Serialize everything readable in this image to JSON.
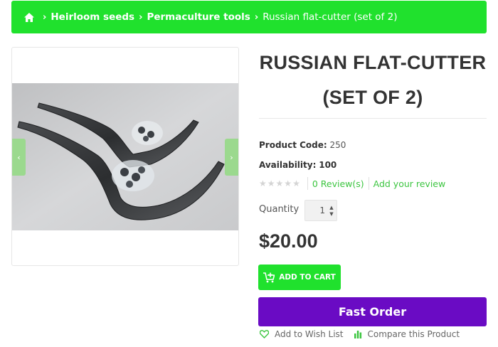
{
  "breadcrumb": {
    "items": [
      "Heirloom seeds",
      "Permaculture tools"
    ],
    "current": "Russian flat-cutter (set of 2)"
  },
  "product": {
    "title_line1": "RUSSIAN FLAT-CUTTER",
    "title_line2": "(SET OF 2)",
    "code_label": "Product Code:",
    "code_value": "250",
    "availability_label": "Availability:",
    "availability_value": "100",
    "rating_stars": 0,
    "reviews_link": "0 Review(s)",
    "add_review_link": "Add your review",
    "quantity_label": "Quantity",
    "quantity_value": "1",
    "price": "$20.00"
  },
  "actions": {
    "add_to_cart": "ADD TO CART",
    "fast_order": "Fast Order",
    "wishlist": "Add to Wish List",
    "compare": "Compare this Product"
  },
  "colors": {
    "accent_green": "#20e12d",
    "fast_order_purple": "#6a0bc4",
    "link_green": "#3cc540"
  }
}
